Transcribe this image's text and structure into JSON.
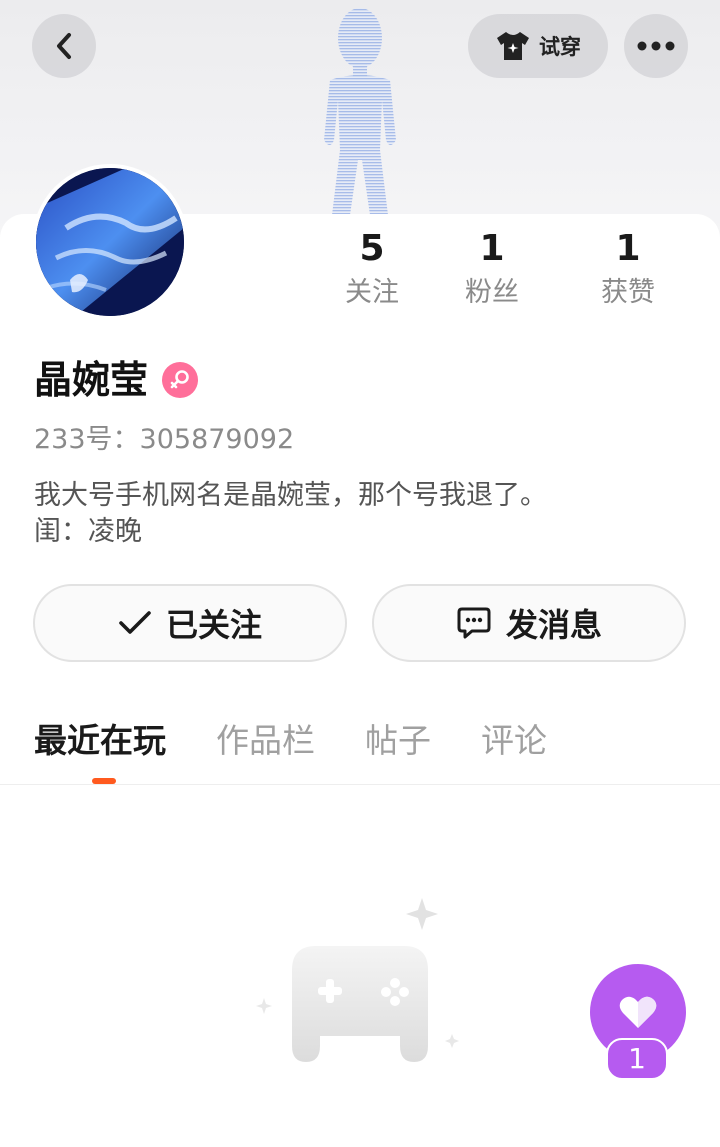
{
  "header": {
    "tryon_label": "试穿"
  },
  "profile": {
    "name": "晶婉莹",
    "uid": "233号：305879092",
    "bio_line1": "我大号手机网名是晶婉莹，那个号我退了。",
    "bio_line2": "闺：凌晚",
    "gender": "female"
  },
  "stats": [
    {
      "value": "5",
      "label": "关注"
    },
    {
      "value": "1",
      "label": "粉丝"
    },
    {
      "value": "1",
      "label": "获赞"
    }
  ],
  "actions": {
    "follow_label": "已关注",
    "message_label": "发消息"
  },
  "tabs": [
    {
      "label": "最近在玩",
      "active": true
    },
    {
      "label": "作品栏",
      "active": false
    },
    {
      "label": "帖子",
      "active": false
    },
    {
      "label": "评论",
      "active": false
    }
  ],
  "like_fab": {
    "count": "1"
  },
  "colors": {
    "accent_orange": "#ff5a1f",
    "like_purple": "#b65bf0",
    "gender_pink": "#ff6f9a"
  }
}
